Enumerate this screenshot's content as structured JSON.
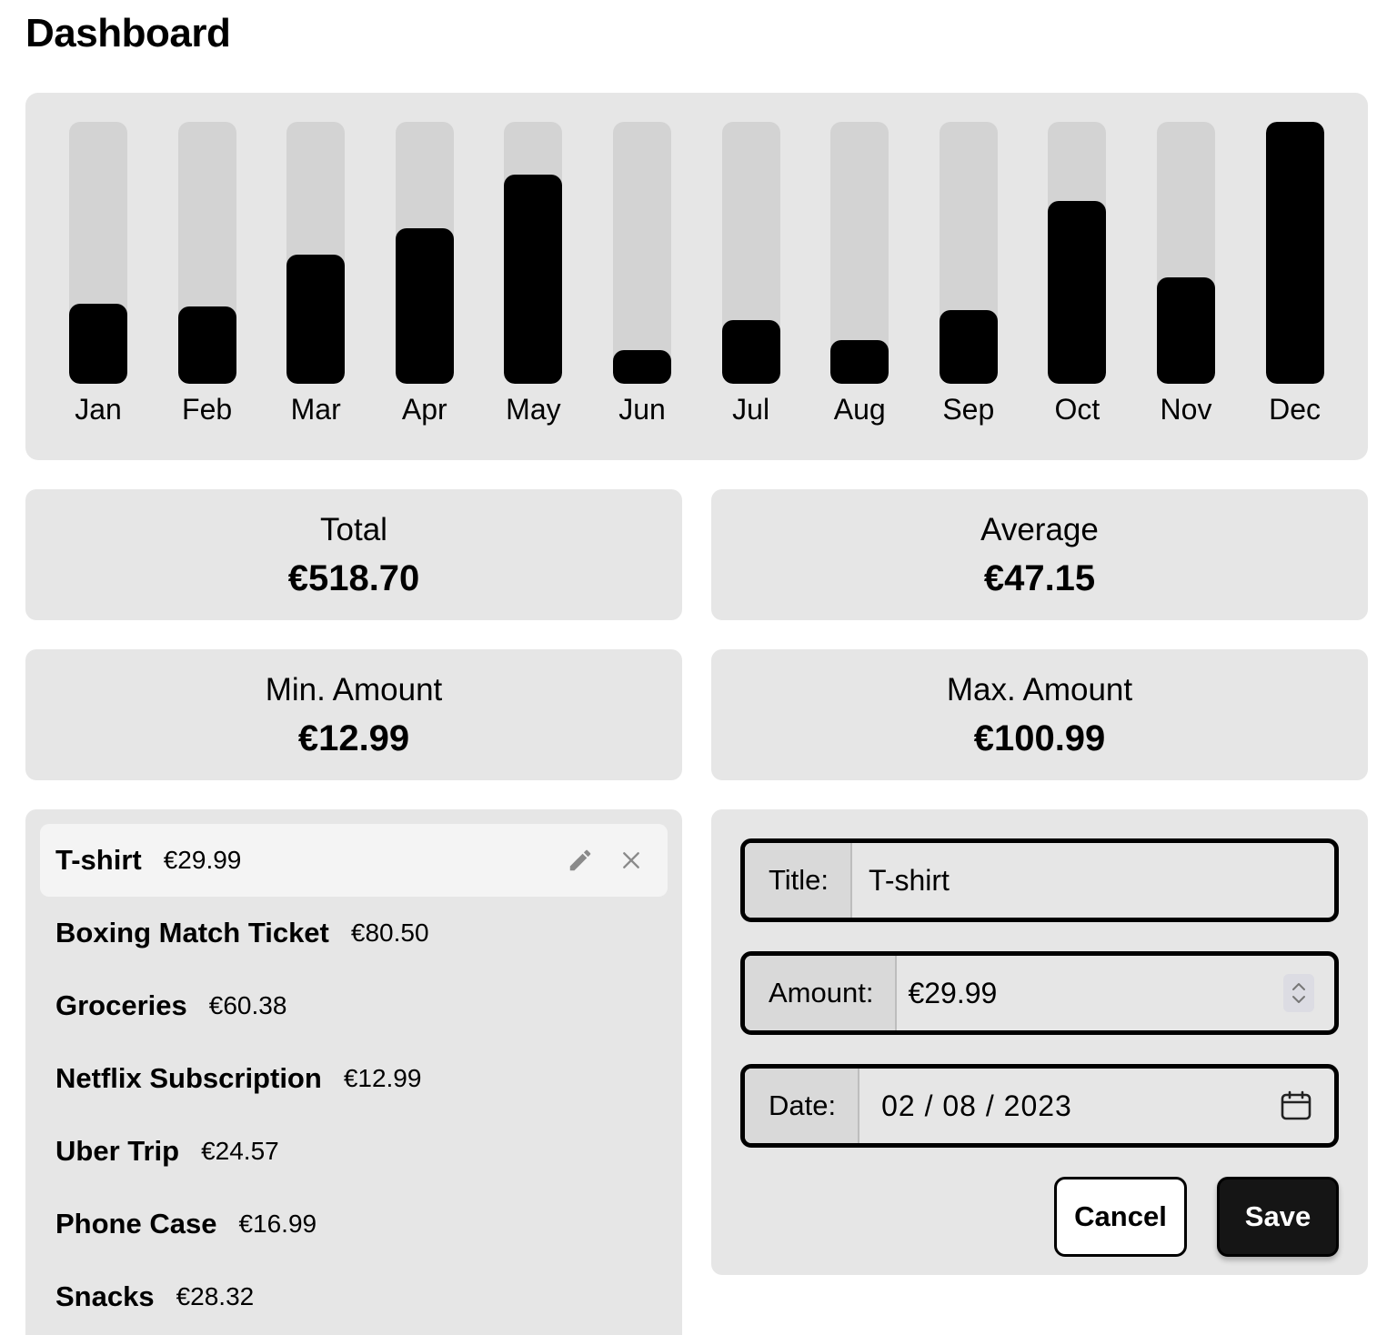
{
  "page": {
    "title": "Dashboard"
  },
  "chart_data": {
    "type": "bar",
    "categories": [
      "Jan",
      "Feb",
      "Mar",
      "Apr",
      "May",
      "Jun",
      "Jul",
      "Aug",
      "Sep",
      "Oct",
      "Nov",
      "Dec"
    ],
    "values": [
      30.8,
      29.8,
      49.9,
      59.9,
      80.5,
      12.99,
      24.6,
      16.99,
      28.3,
      70.4,
      40.9,
      100.99
    ],
    "ylim": [
      0,
      100.99
    ],
    "title": "",
    "xlabel": "",
    "ylabel": ""
  },
  "stats": {
    "total": {
      "label": "Total",
      "value": "€518.70"
    },
    "average": {
      "label": "Average",
      "value": "€47.15"
    },
    "min": {
      "label": "Min. Amount",
      "value": "€12.99"
    },
    "max": {
      "label": "Max. Amount",
      "value": "€100.99"
    }
  },
  "expenses": [
    {
      "title": "T-shirt",
      "amount": "€29.99",
      "selected": true
    },
    {
      "title": "Boxing Match Ticket",
      "amount": "€80.50"
    },
    {
      "title": "Groceries",
      "amount": "€60.38"
    },
    {
      "title": "Netflix Subscription",
      "amount": "€12.99"
    },
    {
      "title": "Uber Trip",
      "amount": "€24.57"
    },
    {
      "title": "Phone Case",
      "amount": "€16.99"
    },
    {
      "title": "Snacks",
      "amount": "€28.32"
    }
  ],
  "icons": {
    "edit": "pencil-icon",
    "delete": "close-icon",
    "calendar": "calendar-icon",
    "stepper": "chevron-up-down-icon"
  },
  "form": {
    "title_label": "Title:",
    "title_value": "T-shirt",
    "amount_label": "Amount:",
    "amount_value": "€29.99",
    "date_label": "Date:",
    "date_value": "02 / 08 / 2023",
    "cancel_label": "Cancel",
    "save_label": "Save"
  },
  "colors": {
    "card": "#e6e6e6",
    "bar_track": "#d3d3d3",
    "bar_fill": "#000000",
    "selected_row": "#f4f4f4",
    "save_button": "#151515"
  }
}
